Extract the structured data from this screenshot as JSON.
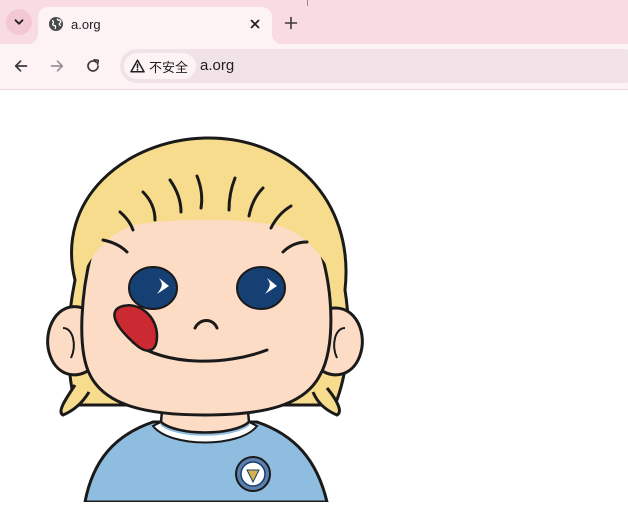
{
  "window": {
    "tab": {
      "title": "a.org",
      "favicon": "globe-icon",
      "close_icon": "close-icon"
    },
    "tab_menu_icon": "chevron-down-icon",
    "new_tab_icon": "plus-icon"
  },
  "toolbar": {
    "back_icon": "arrow-left-icon",
    "forward_icon": "arrow-right-icon",
    "reload_icon": "reload-icon",
    "security_icon": "warning-triangle-icon",
    "security_label": "不安全",
    "url": "a.org"
  },
  "page": {
    "image": "cartoon-child-face",
    "colors": {
      "tab_strip": "#f9dbe3",
      "toolbar": "#fdf2f4",
      "omnibox": "#f1e2e8",
      "hair": "#f6dc8c",
      "skin": "#fddcc6",
      "eyes": "#163f73",
      "tongue": "#cc2a33",
      "shirt": "#8fbde0"
    }
  }
}
